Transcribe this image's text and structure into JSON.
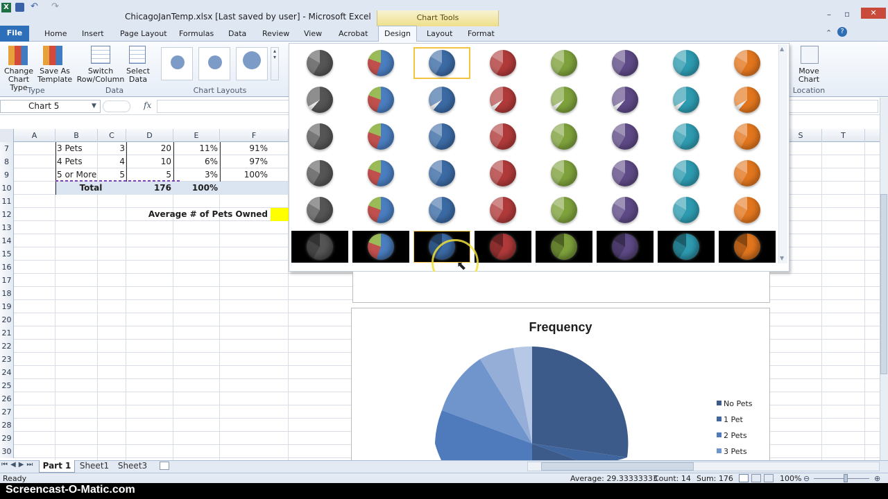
{
  "window": {
    "title": "ChicagoJanTemp.xlsx [Last saved by user]  -  Microsoft Excel",
    "context_tab_group": "Chart Tools"
  },
  "ribbon_tabs": {
    "file": "File",
    "home": "Home",
    "insert": "Insert",
    "page_layout": "Page Layout",
    "formulas": "Formulas",
    "data": "Data",
    "review": "Review",
    "view": "View",
    "acrobat": "Acrobat",
    "design": "Design",
    "layout": "Layout",
    "format": "Format"
  },
  "ribbon": {
    "change_chart_type": "Change Chart Type",
    "save_as_template": "Save As Template",
    "switch_row_column": "Switch Row/Column",
    "select_data": "Select Data",
    "move_chart": "Move Chart",
    "group_type": "Type",
    "group_data": "Data",
    "group_chart_layouts": "Chart Layouts",
    "group_location": "Location"
  },
  "formula_bar": {
    "name_box": "Chart 5",
    "fx": "fx"
  },
  "columns": [
    "A",
    "B",
    "C",
    "D",
    "E",
    "F",
    "S",
    "T"
  ],
  "rows": [
    "7",
    "8",
    "9",
    "10",
    "11",
    "12",
    "13",
    "14",
    "15",
    "16",
    "17",
    "18",
    "19",
    "20",
    "21",
    "22",
    "23",
    "24",
    "25",
    "26",
    "27",
    "28",
    "29",
    "30"
  ],
  "table": [
    {
      "label": "3 Pets",
      "c": "3",
      "d": "20",
      "e": "11%",
      "f": "91%"
    },
    {
      "label": "4 Pets",
      "c": "4",
      "d": "10",
      "e": "6%",
      "f": "97%"
    },
    {
      "label": "5 or More",
      "c": "5",
      "d": "5",
      "e": "3%",
      "f": "100%"
    },
    {
      "label": "Total",
      "c": "",
      "d": "176",
      "e": "100%",
      "f": ""
    }
  ],
  "avg_label": "Average # of Pets Owned",
  "chart_data": {
    "type": "pie",
    "title": "Frequency",
    "legend": [
      "No Pets",
      "1 Pet",
      "2 Pets",
      "3 Pets"
    ],
    "legend_position": "right"
  },
  "sheets": [
    "Part 1",
    "Sheet1",
    "Sheet3"
  ],
  "status": {
    "ready": "Ready",
    "average": "Average: 29.33333333",
    "count": "Count: 14",
    "sum": "Sum: 176",
    "zoom": "100%"
  },
  "watermark": "Screencast-O-Matic.com",
  "colors": {
    "gray": "#555555",
    "multi": "#4a7ec0",
    "blue": "#3b6aa4",
    "red": "#b03a3a",
    "green": "#7ea13c",
    "purple": "#5e4a86",
    "teal": "#2e9bb0",
    "orange": "#e2761e"
  }
}
